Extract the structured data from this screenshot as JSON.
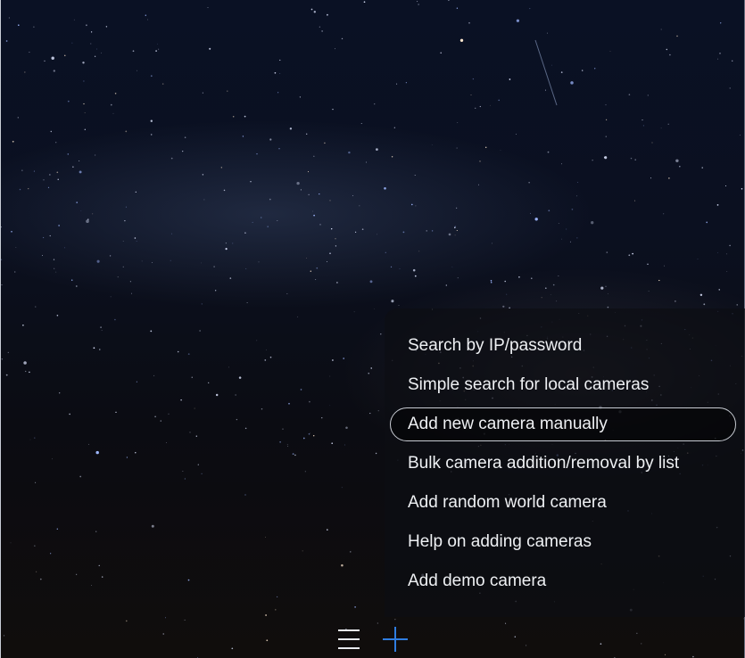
{
  "menu": {
    "items": [
      {
        "label": "Search by IP/password",
        "selected": false
      },
      {
        "label": "Simple search for local cameras",
        "selected": false
      },
      {
        "label": "Add new camera manually",
        "selected": true
      },
      {
        "label": "Bulk camera addition/removal by list",
        "selected": false
      },
      {
        "label": "Add random world camera",
        "selected": false
      },
      {
        "label": "Help on adding cameras",
        "selected": false
      },
      {
        "label": "Add demo camera",
        "selected": false
      }
    ]
  },
  "toolbar": {
    "menu_icon": "hamburger-menu-icon",
    "add_icon": "plus-icon",
    "menu_icon_color": "#e8eaee",
    "add_icon_color": "#2f7de0"
  }
}
